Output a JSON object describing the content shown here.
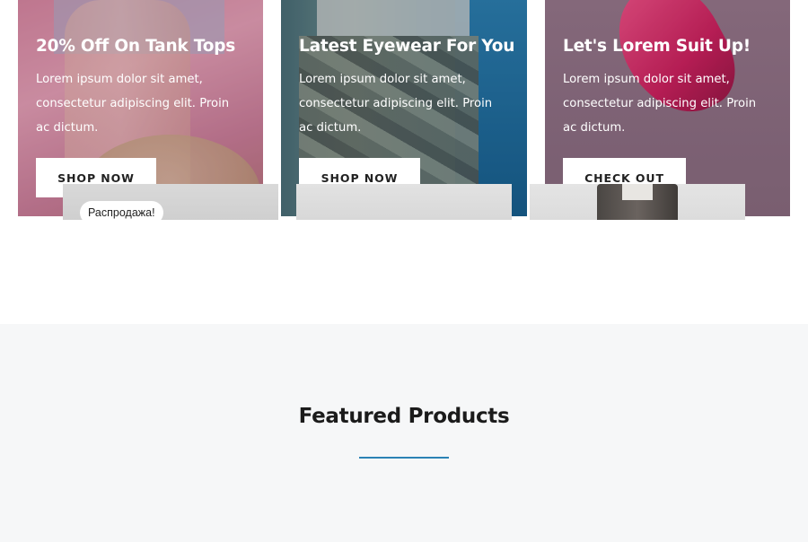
{
  "promos": [
    {
      "title": "20% Off On Tank Tops",
      "text": "Lorem ipsum dolor sit amet, consectetur adipiscing elit. Proin ac dictum.",
      "button": "SHOP NOW"
    },
    {
      "title": "Latest Eyewear For You",
      "text": "Lorem ipsum dolor sit amet, consectetur adipiscing elit. Proin ac dictum.",
      "button": "SHOP NOW"
    },
    {
      "title": "Let's Lorem Suit Up!",
      "text": "Lorem ipsum dolor sit amet, consectetur adipiscing elit. Proin ac dictum.",
      "button": "CHECK OUT"
    }
  ],
  "featured": {
    "title": "Featured Products",
    "accent_color": "#2b82b5",
    "products": [
      {
        "badge": "Распродажа!"
      },
      {},
      {}
    ]
  }
}
